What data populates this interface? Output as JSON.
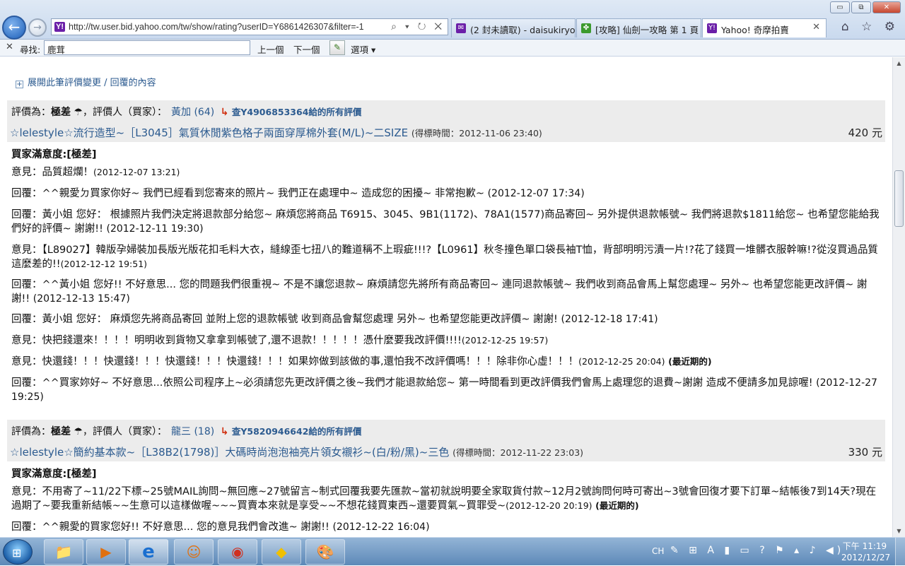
{
  "browser": {
    "window_buttons": {
      "minimize": "▭",
      "restore": "⧉",
      "close": "✕"
    },
    "address": "http://tw.user.bid.yahoo.com/tw/show/rating?userID=Y6861426307&filter=-1",
    "address_actions": "⌕ ▾ ↻ ✕",
    "tabs": [
      {
        "label": "(2 封未讀取) - daisukiryo...",
        "icon_color": "#6b1fa8"
      },
      {
        "label": "[攻略] 仙劍一攻略 第 1 頁 ...",
        "icon_color": "#3c9a2e"
      },
      {
        "label": "Yahoo! 奇摩拍賣",
        "icon_color": "#6b1fa8",
        "close": "✕"
      }
    ],
    "right_icons": "⌂ ☆ ⚙"
  },
  "findbar": {
    "close": "✕",
    "label": "尋找:",
    "query": "鹿茸",
    "prev": "上一個",
    "next": "下一個",
    "highlight": "✎",
    "options": "選項 ▾"
  },
  "page": {
    "expand_text": "展開此筆評價變更 / 回覆的內容",
    "expand_box": "+",
    "reviews": [
      {
        "rating_prefix": "評價為：",
        "rating": "極差",
        "rating_icon": "☂",
        "rater_prefix": "，評價人（買家）：",
        "rater": "黃加",
        "rater_score": "(64)",
        "arrow": "↳",
        "query_link": "查Y4906853364給的所有評價",
        "item_title": "☆lelestyle☆流行造型~［L3045］氣質休閒紫色格子兩面穿厚棉外套(M/L)~二SIZE",
        "item_time": "(得標時間：2012-11-06 23:40)",
        "price": "420 元",
        "satisfaction": "買家滿意度:[極差]",
        "messages": [
          {
            "prefix": "意見：",
            "text": "品質超爛！",
            "time": "(2012-12-07 13:21)",
            "time_small": true
          },
          {
            "prefix": "回覆：",
            "text": "^^親愛ㄉ買家你好~ 我們已經看到您寄來的照片~ 我們正在處理中~ 造成您的困擾~ 非常抱歉~",
            "time": "(2012-12-07 17:34)"
          },
          {
            "prefix": "回覆：",
            "text": "黃小姐 您好： 根據照片我們決定將退款部分給您~ 麻煩您將商品 T6915、3045、9B1(1172)、78A1(1577)商品寄回~ 另外提供退款帳號~ 我們將退款$1811給您~ 也希望您能給我們好的評價~ 謝謝!!",
            "time": "(2012-12-11 19:30)"
          },
          {
            "prefix": "意見：",
            "text": "【L89027】韓版孕婦裝加長版光版花扣毛料大衣，縫線歪七扭八的難道稱不上瑕疵!!!?【L0961】秋冬撞色單口袋長袖T恤，背部明明污漬一片!?花了錢買一堆髒衣服幹嘛!?從沒買過品質這麼差的!!",
            "time": "(2012-12-12 19:51)",
            "time_small": true
          },
          {
            "prefix": "回覆：",
            "text": "^^黃小姐 您好!! 不好意思... 您的問題我們很重視~ 不是不讓您退款~ 麻煩請您先將所有商品寄回~ 連同退款帳號~ 我們收到商品會馬上幫您處理~ 另外~ 也希望您能更改評價~ 謝謝!!",
            "time": "(2012-12-13 15:47)"
          },
          {
            "prefix": "回覆：",
            "text": "黃小姐 您好： 麻煩您先將商品寄回 並附上您的退款帳號 收到商品會幫您處理 另外~ 也希望您能更改評價~ 謝謝!",
            "time": "(2012-12-18 17:41)"
          },
          {
            "prefix": "意見：",
            "text": "快把錢還來！！！！明明收到貨物又拿拿到帳號了,還不退款！！！！！憑什麼要我改評價!!!!",
            "time": "(2012-12-25 19:57)",
            "time_small": true
          },
          {
            "prefix": "意見：",
            "text": "快還錢！！！快還錢！！！快還錢！！！快還錢！！！如果妳做到該做的事,還怕我不改評價嗎！！！除非你心虛！！！",
            "time": "(2012-12-25 20:04)",
            "time_small": true,
            "latest": "(最近期的)"
          },
          {
            "prefix": "回覆：",
            "text": "^^買家妳好~ 不好意思...依照公司程序上~必須請您先更改評價之後~我們才能退款給您~ 第一時間看到更改評價我們會馬上處理您的退費~謝謝 造成不便請多加見諒喔!",
            "time": "(2012-12-27 19:25)"
          }
        ]
      },
      {
        "rating_prefix": "評價為：",
        "rating": "極差",
        "rating_icon": "☂",
        "rater_prefix": "，評價人（買家）：",
        "rater": "龍三",
        "rater_score": "(18)",
        "arrow": "↳",
        "query_link": "查Y5820946642給的所有評價",
        "item_title": "☆lelestyle☆簡約基本款~［L38B2(1798)］大碼時尚泡泡袖亮片領女襯衫~(白/粉/黑)~三色",
        "item_time": "(得標時間：2012-11-22 23:03)",
        "price": "330 元",
        "satisfaction": "買家滿意度:[極差]",
        "messages": [
          {
            "prefix": "意見：",
            "text": "不用寄了~11/22下標~25號MAIL詢問~無回應~27號留言~制式回覆我要先匯款~當初就說明要全家取貨付款~12月2號詢問何時可寄出~3號會回復才要下訂單~結帳後7到14天?現在過期了~要我重新結帳~~生意可以這樣做喔~~~買賣本來就是享受~~不想花錢買東西~還要買氣~買罪受~",
            "time": "(2012-12-20 20:19)",
            "time_small": true,
            "latest": "(最近期的)"
          },
          {
            "prefix": "回覆：",
            "text": "^^親愛的買家您好!! 不好意思... 您的意見我們會改進~ 謝謝!!",
            "time": "(2012-12-22 16:04)"
          }
        ]
      }
    ]
  },
  "taskbar": {
    "start_glyph": "⊞",
    "apps": [
      {
        "name": "explorer",
        "glyph": "📁"
      },
      {
        "name": "media-player",
        "glyph": "▶"
      },
      {
        "name": "internet-explorer",
        "glyph": "e"
      },
      {
        "name": "pps",
        "glyph": "☺"
      },
      {
        "name": "chrome",
        "glyph": "◉"
      },
      {
        "name": "kmplayer",
        "glyph": "◆"
      },
      {
        "name": "paint",
        "glyph": "🎨"
      }
    ],
    "ime": "CH",
    "tray_icons": "✎ ⊞ A ▮ ▭ ? ⚑ ▴ ♪ ◀)",
    "clock_time": "下午 11:19",
    "clock_date": "2012/12/27"
  }
}
